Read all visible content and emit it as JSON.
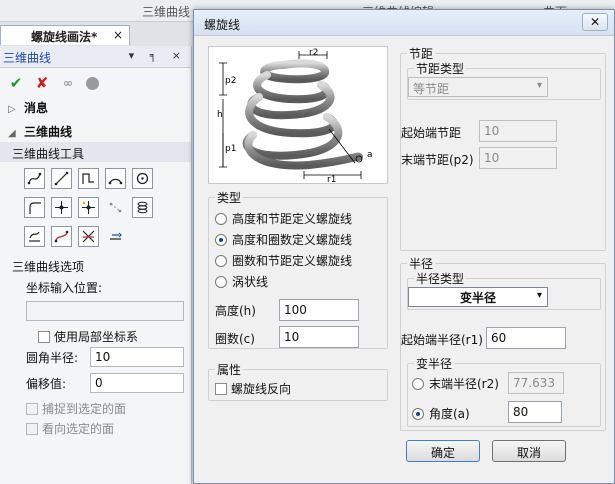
{
  "bg_tabs": [
    "三维曲线",
    "三维曲线编辑",
    "曲面"
  ],
  "doc_tab": {
    "title": "螺旋线画法*",
    "close": "×"
  },
  "left_panel": {
    "title": "三维曲线",
    "ctrls": "▾ ╕ ×",
    "sections": [
      {
        "label": "消息",
        "arrow": "▷"
      },
      {
        "label": "三维曲线",
        "arrow": "◢"
      }
    ],
    "tools_label": "三维曲线工具",
    "options_label": "三维曲线选项",
    "coord_label": "坐标输入位置:",
    "coord_value": "",
    "use_local": "使用局部坐标系",
    "fillet_label": "圆角半径:",
    "fillet_value": "10",
    "offset_label": "偏移值:",
    "offset_value": "0",
    "snap_label": "捕捉到选定的面",
    "look_label": "看向选定的面"
  },
  "dialog": {
    "title": "螺旋线",
    "close": "✕",
    "preview_labels": {
      "r2": "r2",
      "p2": "p2",
      "h": "h",
      "p1": "p1",
      "a": "a",
      "r1": "r1"
    },
    "type_group": "类型",
    "types": [
      "高度和节距定义螺旋线",
      "高度和圈数定义螺旋线",
      "圈数和节距定义螺旋线",
      "涡状线"
    ],
    "selected_type": 1,
    "height_label": "高度(h)",
    "height_value": "100",
    "turns_label": "圈数(c)",
    "turns_value": "10",
    "attr_group": "属性",
    "reverse_label": "螺旋线反向",
    "pitch_group": "节距",
    "pitch_type_group": "节距类型",
    "pitch_type_value": "等节距",
    "start_pitch_label": "起始端节距",
    "start_pitch_value": "10",
    "end_pitch_label": "末端节距(p2)",
    "end_pitch_value": "10",
    "radius_group": "半径",
    "radius_type_group": "半径类型",
    "radius_type_value": "变半径",
    "start_radius_label": "起始端半径(r1)",
    "start_radius_value": "60",
    "var_radius_group": "变半径",
    "end_radius_label": "末端半径(r2)",
    "end_radius_value": "77.633",
    "angle_label": "角度(a)",
    "angle_value": "80",
    "ok_label": "确定",
    "cancel_label": "取消"
  },
  "colors": {
    "accent": "#1f4aa8",
    "ok_green": "#1a9a22",
    "cancel_red": "#d21a1a"
  }
}
